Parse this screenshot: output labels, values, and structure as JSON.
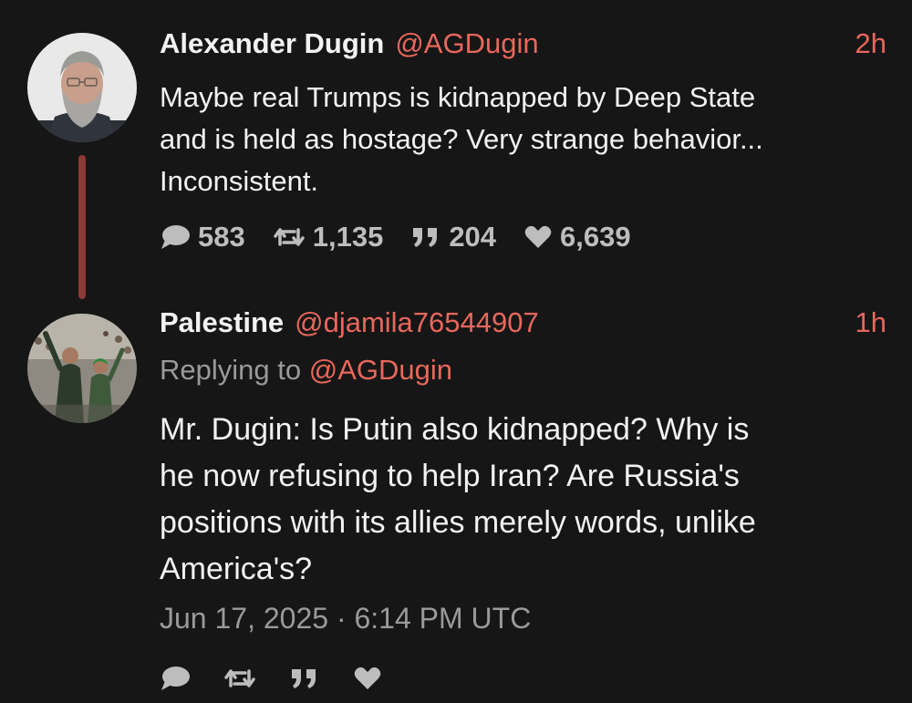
{
  "original_tweet": {
    "author_name": "Alexander Dugin",
    "author_handle": "@AGDugin",
    "time_ago": "2h",
    "text": "Maybe real Trumps is kidnapped by Deep State\nand is held as hostage? Very strange behavior...\nInconsistent.",
    "stats": {
      "replies": "583",
      "retweets": "1,135",
      "quotes": "204",
      "likes": "6,639"
    },
    "avatar_icon": "bearded-man-avatar"
  },
  "reply_tweet": {
    "author_name": "Palestine",
    "author_handle": "@djamila76544907",
    "time_ago": "1h",
    "replying_to_prefix": "Replying to",
    "replying_to_handle": "@AGDugin",
    "text": "Mr. Dugin: Is Putin also kidnapped? Why is\nhe now refusing to help Iran? Are Russia's\npositions with its allies merely words, unlike\nAmerica's?",
    "timestamp": "Jun 17, 2025 · 6:14 PM UTC",
    "avatar_icon": "crowd-photo-avatar"
  },
  "colors": {
    "background": "#161616",
    "accent": "#e8675c",
    "thread_line": "#8b3a37",
    "muted": "#9a9a9a"
  }
}
